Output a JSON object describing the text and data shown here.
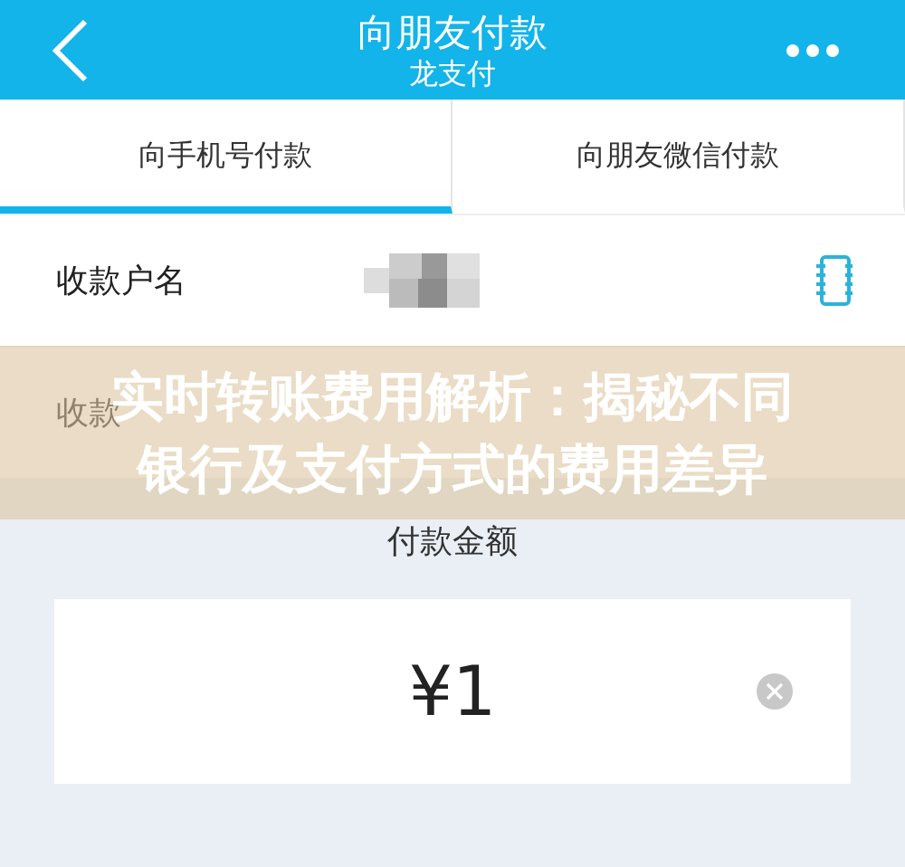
{
  "header": {
    "title": "向朋友付款",
    "subtitle": "龙支付"
  },
  "tabs": [
    {
      "label": "向手机号付款",
      "selected": true
    },
    {
      "label": "向朋友微信付款",
      "selected": false
    }
  ],
  "fields": [
    {
      "label": "收款户名",
      "kind": "contact"
    },
    {
      "label": "收款",
      "kind": "plain"
    }
  ],
  "amount": {
    "label": "付款金额",
    "value": "¥1"
  },
  "banner": {
    "lines": [
      "实时转账费用解析：揭秘不同",
      "银行及支付方式的费用差异"
    ]
  }
}
